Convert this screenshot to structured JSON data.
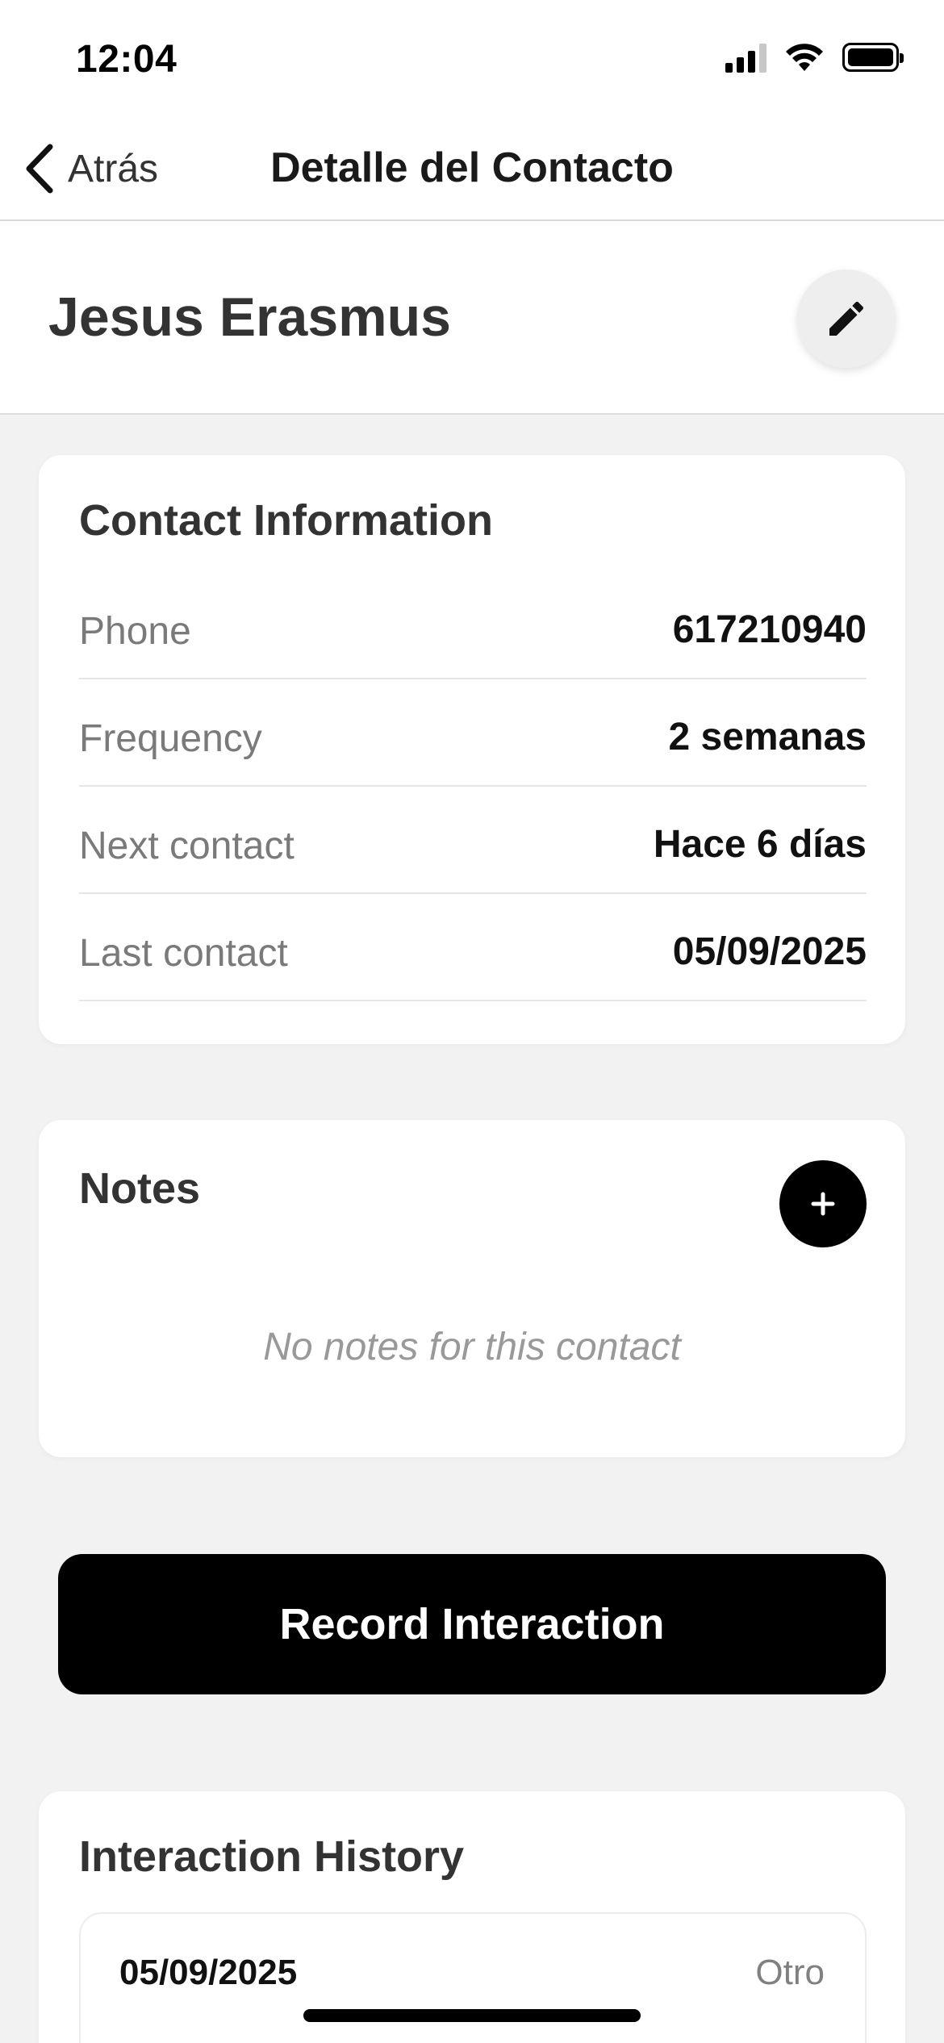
{
  "status_bar": {
    "time": "12:04",
    "signal_icon": "cellular-signal-icon",
    "wifi_icon": "wifi-icon",
    "battery_icon": "battery-icon"
  },
  "nav": {
    "back_label": "Atrás",
    "title": "Detalle del Contacto"
  },
  "contact": {
    "name": "Jesus Erasmus",
    "edit_icon": "pencil-icon"
  },
  "contact_information": {
    "title": "Contact Information",
    "rows": [
      {
        "label": "Phone",
        "value": "617210940"
      },
      {
        "label": "Frequency",
        "value": "2 semanas"
      },
      {
        "label": "Next contact",
        "value": "Hace 6 días"
      },
      {
        "label": "Last contact",
        "value": "05/09/2025"
      }
    ]
  },
  "notes": {
    "title": "Notes",
    "add_icon": "plus-icon",
    "empty_text": "No notes for this contact"
  },
  "record_button_label": "Record Interaction",
  "interaction_history": {
    "title": "Interaction History",
    "items": [
      {
        "date": "05/09/2025",
        "type": "Otro"
      }
    ]
  },
  "colors": {
    "background": "#f2f2f2",
    "card": "#ffffff",
    "primary_button": "#000000",
    "label_gray": "#7a7a7a"
  }
}
